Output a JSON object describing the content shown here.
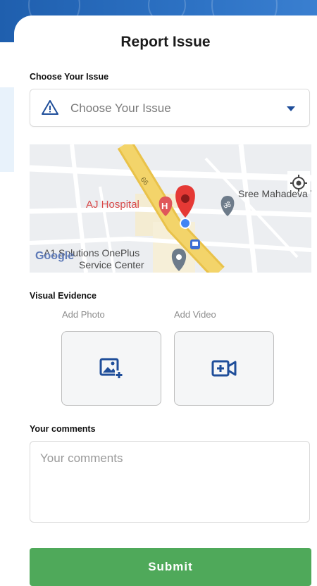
{
  "title": "Report Issue",
  "issue": {
    "label": "Choose Your Issue",
    "placeholder": "Choose Your Issue"
  },
  "map": {
    "places": {
      "hospital": "AJ Hospital",
      "temple": "Sree Mahadeva T",
      "store_line1": "A1 Solutions OnePlus",
      "store_line2": "Service Center"
    },
    "road_label": "66",
    "brand": "Google",
    "icons": [
      "hospital-icon",
      "location-pin-icon",
      "temple-icon",
      "bus-stop-icon",
      "store-pin-icon",
      "my-location-icon"
    ]
  },
  "evidence": {
    "label": "Visual Evidence",
    "add_photo": "Add Photo",
    "add_video": "Add Video"
  },
  "comments": {
    "label": "Your comments",
    "placeholder": "Your comments"
  },
  "submit_label": "Submit",
  "colors": {
    "header_blue": "#2d72c4",
    "accent_blue": "#1f4e9a",
    "submit_green": "#4fa95a",
    "pin_red": "#e53935"
  }
}
